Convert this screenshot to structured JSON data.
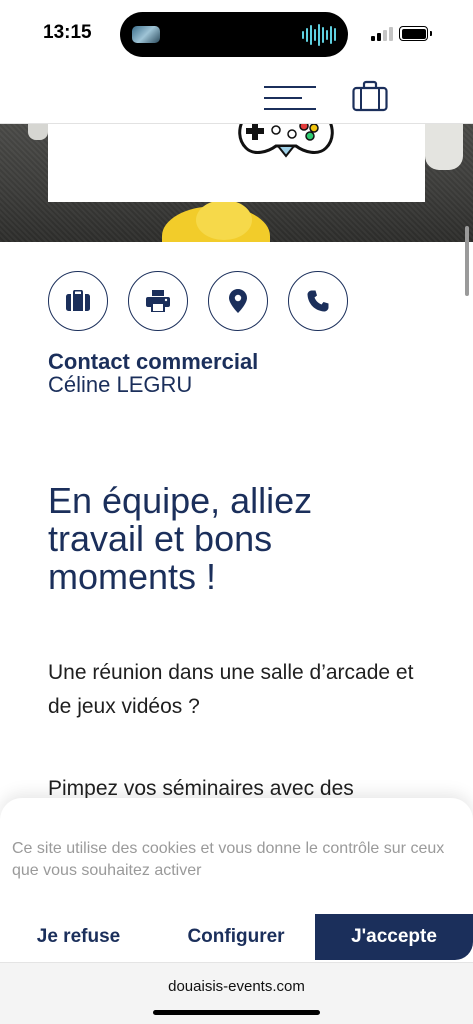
{
  "status_bar": {
    "time": "13:15",
    "signal_bars_active": 2,
    "signal_bars_total": 4,
    "battery_level": 1.0
  },
  "header": {
    "menu_icon": "hamburger-menu-icon",
    "bag_icon": "briefcase-icon"
  },
  "hero": {
    "logo_icon": "gamepad-icon"
  },
  "action_buttons": [
    {
      "icon": "briefcase-icon"
    },
    {
      "icon": "printer-icon"
    },
    {
      "icon": "location-pin-icon"
    },
    {
      "icon": "phone-icon"
    }
  ],
  "contact": {
    "title": "Contact commercial",
    "name": "Céline LEGRU"
  },
  "content": {
    "heading": "En équipe, alliez travail et bons moments !",
    "paragraph1": "Une réunion dans une salle d’arcade et de jeux vidéos ?",
    "paragraph2": "Pimpez vos séminaires avec des"
  },
  "cookie_banner": {
    "text": "Ce site utilise des cookies et vous donne le contrôle sur ceux que vous souhaitez activer",
    "refuse_label": "Je refuse",
    "configure_label": "Configurer",
    "accept_label": "J'accepte"
  },
  "browser": {
    "url": "douaisis-events.com"
  },
  "colors": {
    "brand_navy": "#1b2f5b",
    "accent_yellow": "#f2cc2a"
  }
}
